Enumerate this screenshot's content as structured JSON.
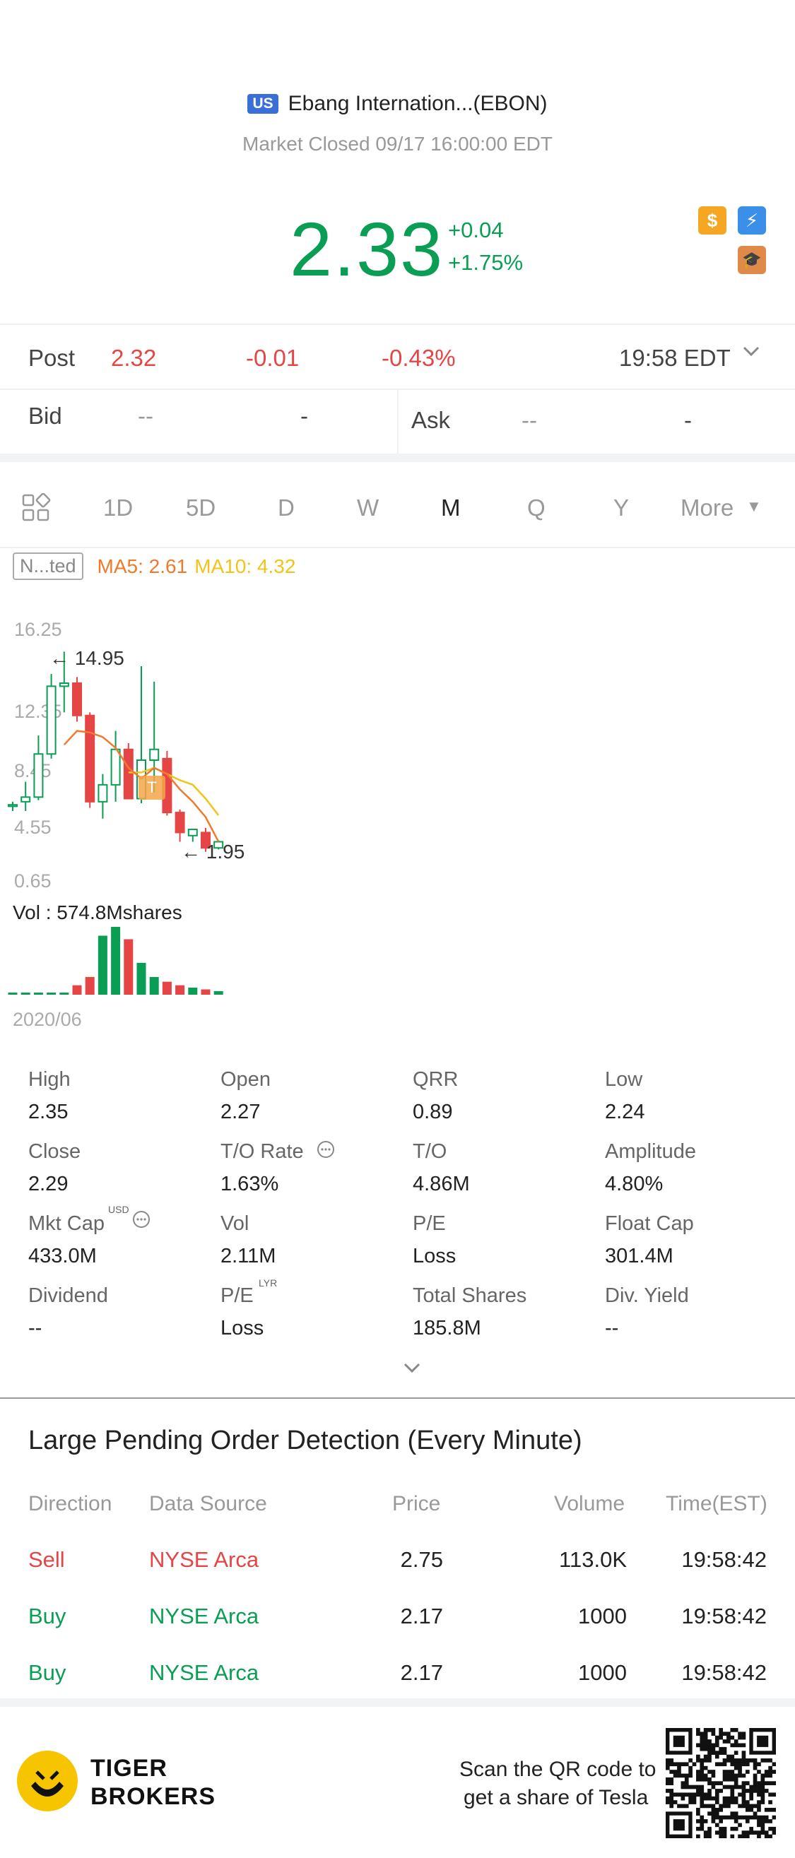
{
  "header": {
    "market_badge": "US",
    "title": "Ebang Internation...(EBON)",
    "status": "Market Closed 09/17 16:00:00 EDT"
  },
  "quote": {
    "price": "2.33",
    "change": "+0.04",
    "change_pct": "+1.75%"
  },
  "post": {
    "label": "Post",
    "price": "2.32",
    "change": "-0.01",
    "change_pct": "-0.43%",
    "time": "19:58 EDT"
  },
  "bidask": {
    "bid_label": "Bid",
    "bid_price": "--",
    "bid_size": "-",
    "ask_label": "Ask",
    "ask_price": "--",
    "ask_size": "-"
  },
  "tabs": [
    "1D",
    "5D",
    "D",
    "W",
    "M",
    "Q",
    "Y",
    "More"
  ],
  "chart_legend": {
    "adjust": "N...ted",
    "ma5": "MA5: 2.61",
    "ma10": "MA10: 4.32"
  },
  "chart_axis": {
    "y_ticks": [
      "16.25",
      "12.35",
      "8.45",
      "4.55",
      "0.65"
    ],
    "high_marker": "14.95",
    "low_marker": "1.95",
    "vol_label": "Vol  : 574.8Mshares",
    "x_start": "2020/06"
  },
  "colors": {
    "up": "#0a9e55",
    "down": "#e54545",
    "ma5": "#f07a2b",
    "ma10": "#f2c31b",
    "accent": "#3a6fd8"
  },
  "chart_data": {
    "type": "candlestick",
    "ylim": [
      0.65,
      16.25
    ],
    "candles": [
      {
        "o": 4.9,
        "h": 5.2,
        "l": 4.6,
        "c": 5.0
      },
      {
        "o": 5.2,
        "h": 6.5,
        "l": 4.6,
        "c": 5.5
      },
      {
        "o": 5.5,
        "h": 9.5,
        "l": 5.3,
        "c": 8.3
      },
      {
        "o": 8.3,
        "h": 13.5,
        "l": 8.0,
        "c": 12.7
      },
      {
        "o": 12.7,
        "h": 14.95,
        "l": 11.0,
        "c": 12.9
      },
      {
        "o": 12.9,
        "h": 13.3,
        "l": 10.4,
        "c": 10.8
      },
      {
        "o": 10.8,
        "h": 11.0,
        "l": 4.8,
        "c": 5.2
      },
      {
        "o": 5.2,
        "h": 7.0,
        "l": 4.1,
        "c": 6.3
      },
      {
        "o": 6.3,
        "h": 9.8,
        "l": 5.2,
        "c": 8.6
      },
      {
        "o": 8.6,
        "h": 9.0,
        "l": 5.6,
        "c": 5.4
      },
      {
        "o": 5.4,
        "h": 14.0,
        "l": 5.1,
        "c": 7.9
      },
      {
        "o": 7.9,
        "h": 13.0,
        "l": 5.8,
        "c": 8.6
      },
      {
        "o": 8.0,
        "h": 8.5,
        "l": 4.3,
        "c": 4.5
      },
      {
        "o": 4.5,
        "h": 4.7,
        "l": 2.6,
        "c": 3.2
      },
      {
        "o": 3.0,
        "h": 3.4,
        "l": 2.6,
        "c": 3.4
      },
      {
        "o": 3.2,
        "h": 3.5,
        "l": 1.95,
        "c": 2.2
      },
      {
        "o": 2.2,
        "h": 2.7,
        "l": 2.1,
        "c": 2.6
      }
    ],
    "ma5": [
      null,
      null,
      null,
      null,
      8.9,
      9.8,
      9.7,
      9.4,
      8.7,
      7.4,
      6.7,
      7.4,
      7.0,
      6.0,
      5.2,
      4.2,
      2.61
    ],
    "ma10": [
      null,
      null,
      null,
      null,
      null,
      null,
      null,
      null,
      null,
      7.1,
      7.1,
      7.4,
      7.0,
      6.6,
      6.3,
      5.4,
      4.32
    ],
    "volume": {
      "max": 574.8,
      "values": [
        10,
        8,
        10,
        12,
        15,
        80,
        150,
        500,
        574.8,
        470,
        270,
        150,
        110,
        80,
        60,
        45,
        30
      ]
    }
  },
  "stats": [
    {
      "label": "High",
      "value": "2.35"
    },
    {
      "label": "Open",
      "value": "2.27"
    },
    {
      "label": "QRR",
      "value": "0.89"
    },
    {
      "label": "Low",
      "value": "2.24"
    },
    {
      "label": "Close",
      "value": "2.29"
    },
    {
      "label": "T/O Rate",
      "value": "1.63%"
    },
    {
      "label": "T/O",
      "value": "4.86M"
    },
    {
      "label": "Amplitude",
      "value": "4.80%"
    },
    {
      "label": "Mkt Cap",
      "value": "433.0M"
    },
    {
      "label": "Vol",
      "value": "2.11M"
    },
    {
      "label": "P/E",
      "value": "Loss"
    },
    {
      "label": "Float Cap",
      "value": "301.4M"
    },
    {
      "label": "Dividend",
      "value": "--"
    },
    {
      "label": "P/E",
      "value": "Loss"
    },
    {
      "label": "Total Shares",
      "value": "185.8M"
    },
    {
      "label": "Div. Yield",
      "value": "--"
    }
  ],
  "stat_superscripts": {
    "mkt_cap": "USD",
    "pe_lyr": "LYR"
  },
  "large_orders": {
    "title": "Large Pending Order Detection (Every Minute)",
    "headers": [
      "Direction",
      "Data Source",
      "Price",
      "Volume",
      "Time(EST)"
    ],
    "rows": [
      [
        "Sell",
        "NYSE Arca",
        "2.75",
        "113.0K",
        "19:58:42"
      ],
      [
        "Buy",
        "NYSE Arca",
        "2.17",
        "1000",
        "19:58:42"
      ],
      [
        "Buy",
        "NYSE Arca",
        "2.17",
        "1000",
        "19:58:42"
      ]
    ]
  },
  "footer": {
    "brand_line1": "TIGER",
    "brand_line2": "BROKERS",
    "promo_line1": "Scan the QR code to",
    "promo_line2": "get a share of Tesla"
  }
}
